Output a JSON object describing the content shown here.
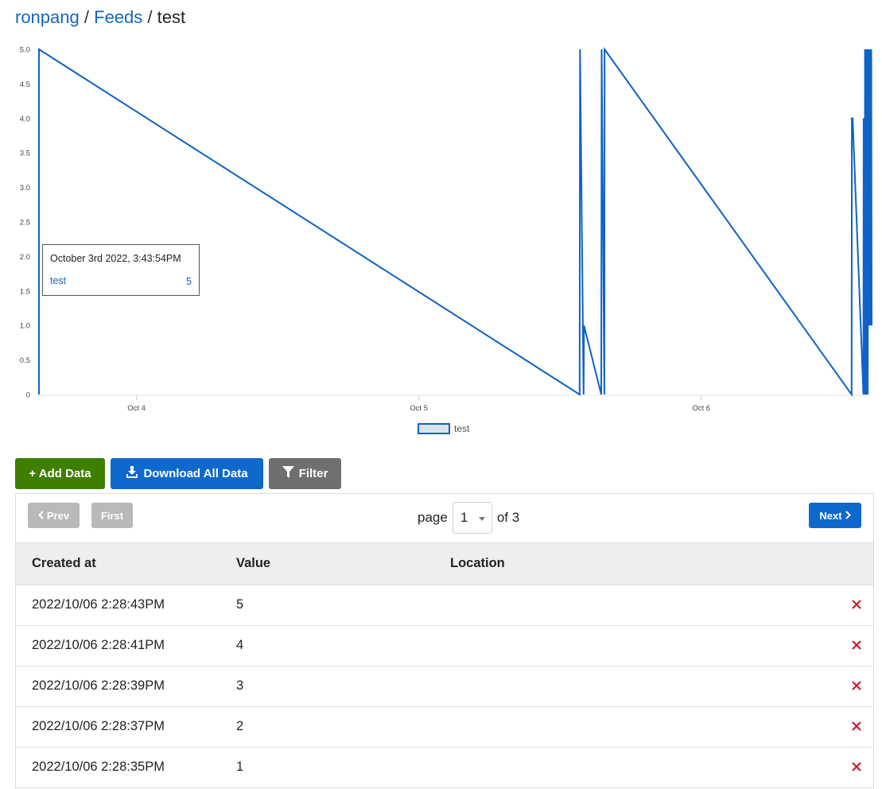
{
  "breadcrumb": {
    "user": "ronpang",
    "sep1": "/",
    "feeds": "Feeds",
    "sep2": "/",
    "current": "test"
  },
  "chart_data": {
    "type": "line",
    "x_unit": "Oct 2022, datetime",
    "y_ticks": [
      "0",
      "0.5",
      "1.0",
      "1.5",
      "2.0",
      "2.5",
      "3.0",
      "3.5",
      "4.0",
      "4.5",
      "5.0"
    ],
    "ylim": [
      0,
      5
    ],
    "x_ticks": [
      {
        "label": "Oct 4",
        "t": "2022-10-04T00:00"
      },
      {
        "label": "Oct 5",
        "t": "2022-10-05T00:00"
      },
      {
        "label": "Oct 6",
        "t": "2022-10-06T00:00"
      }
    ],
    "xlim": [
      "2022-10-03T15:43",
      "2022-10-06T14:29"
    ],
    "series": [
      {
        "name": "test",
        "color": "#0f62c6",
        "points": [
          {
            "t": "2022-10-03T15:43",
            "y": 0
          },
          {
            "t": "2022-10-03T15:43",
            "y": 5
          },
          {
            "t": "2022-10-05T13:40",
            "y": 0
          },
          {
            "t": "2022-10-05T13:42",
            "y": 5
          },
          {
            "t": "2022-10-05T14:00",
            "y": 0
          },
          {
            "t": "2022-10-05T14:02",
            "y": 1
          },
          {
            "t": "2022-10-05T15:30",
            "y": 0
          },
          {
            "t": "2022-10-05T15:32",
            "y": 5
          },
          {
            "t": "2022-10-05T15:46",
            "y": 0
          },
          {
            "t": "2022-10-05T15:47",
            "y": 5
          },
          {
            "t": "2022-10-06T12:47",
            "y": 0
          },
          {
            "t": "2022-10-06T12:48",
            "y": 4
          },
          {
            "t": "2022-10-06T12:52",
            "y": 4
          },
          {
            "t": "2022-10-06T13:47",
            "y": 0
          },
          {
            "t": "2022-10-06T13:48",
            "y": 4
          },
          {
            "t": "2022-10-06T13:54",
            "y": 0
          },
          {
            "t": "2022-10-06T13:55",
            "y": 5
          },
          {
            "t": "2022-10-06T14:01",
            "y": 0
          },
          {
            "t": "2022-10-06T14:03",
            "y": 5
          },
          {
            "t": "2022-10-06T14:09",
            "y": 0
          },
          {
            "t": "2022-10-06T14:11",
            "y": 5
          },
          {
            "t": "2022-10-06T14:13",
            "y": 1
          },
          {
            "t": "2022-10-06T14:15",
            "y": 5
          },
          {
            "t": "2022-10-06T14:17",
            "y": 1
          },
          {
            "t": "2022-10-06T14:19",
            "y": 5
          },
          {
            "t": "2022-10-06T14:21",
            "y": 1
          },
          {
            "t": "2022-10-06T14:23",
            "y": 5
          },
          {
            "t": "2022-10-06T14:25",
            "y": 1
          },
          {
            "t": "2022-10-06T14:27",
            "y": 5
          },
          {
            "t": "2022-10-06T14:29",
            "y": 1
          }
        ]
      }
    ],
    "legend": {
      "label": "test",
      "placement": "bottom-center"
    },
    "tooltip": {
      "date": "October 3rd 2022, 3:43:54PM",
      "series": "test",
      "value": "5"
    },
    "grid": false
  },
  "actions": {
    "add_label": "+ Add Data",
    "download_label": "Download All Data",
    "filter_label": "Filter"
  },
  "pager": {
    "prev_label": "Prev",
    "first_label": "First",
    "page_word": "page",
    "page_value": "1",
    "of_label": "of 3",
    "next_label": "Next"
  },
  "table": {
    "headers": [
      "Created at",
      "Value",
      "Location"
    ],
    "rows": [
      {
        "created": "2022/10/06 2:28:43PM",
        "value": "5",
        "location": ""
      },
      {
        "created": "2022/10/06 2:28:41PM",
        "value": "4",
        "location": ""
      },
      {
        "created": "2022/10/06 2:28:39PM",
        "value": "3",
        "location": ""
      },
      {
        "created": "2022/10/06 2:28:37PM",
        "value": "2",
        "location": ""
      },
      {
        "created": "2022/10/06 2:28:35PM",
        "value": "1",
        "location": ""
      }
    ]
  },
  "colors": {
    "accent_blue": "#0f69cc",
    "add_green": "#3f7f00",
    "filter_gray": "#6f6f6f",
    "delete_red": "#d0182a"
  }
}
